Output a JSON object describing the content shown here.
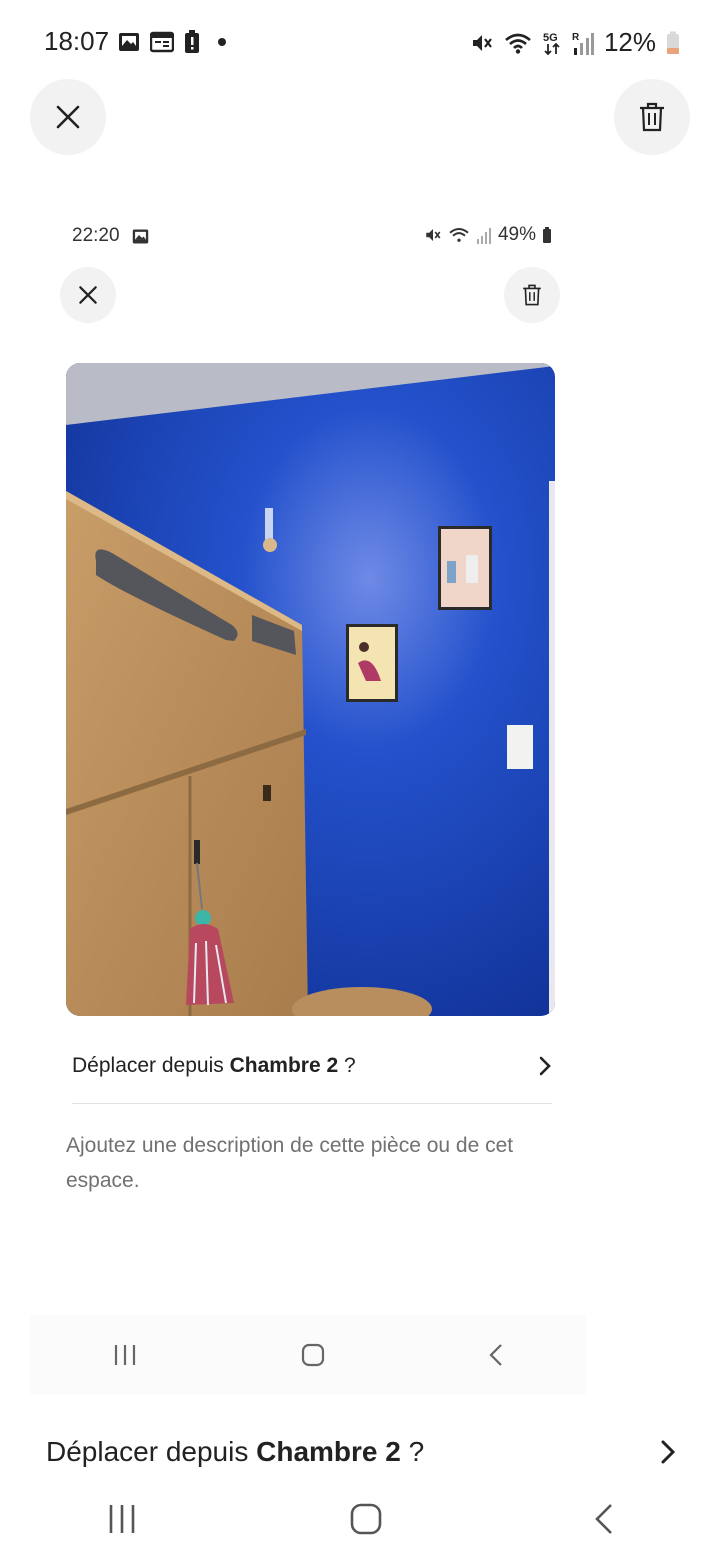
{
  "status_bar": {
    "time": "18:07",
    "battery": "12%",
    "icons_left": [
      "image-icon",
      "calendar-icon",
      "battery-alert-icon",
      "dot-icon"
    ],
    "icons_right": [
      "mute-icon",
      "wifi-icon",
      "5g-icon",
      "signal-icon",
      "battery-icon"
    ],
    "battery_color": "#e8a37a"
  },
  "header": {
    "close_icon": "close-icon",
    "delete_icon": "trash-icon"
  },
  "inner_screenshot": {
    "status_time": "22:20",
    "status_battery": "49%",
    "move_prefix": "Déplacer depuis ",
    "move_room": "Chambre 2",
    "move_suffix": " ?",
    "description_placeholder": "Ajoutez une description de cette pièce ou de cet espace."
  },
  "footer": {
    "move_prefix": "Déplacer depuis ",
    "move_room": "Chambre 2",
    "move_suffix": " ?"
  },
  "colors": {
    "wall_blue": "#1b46b8",
    "button_bg": "#f2f2f2"
  }
}
